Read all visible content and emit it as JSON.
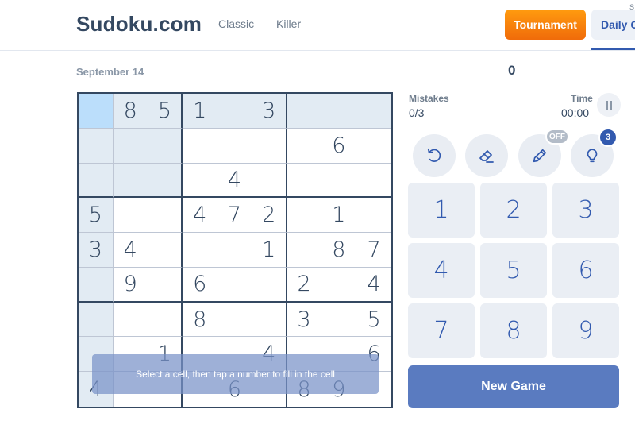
{
  "header": {
    "logo": "Sudoku.com",
    "nav": [
      "Classic",
      "Killer"
    ],
    "tournament_label": "Tournament",
    "daily_label": "Daily C",
    "daily_small": "S"
  },
  "game": {
    "date": "September 14",
    "score": "0",
    "mistakes_label": "Mistakes",
    "mistakes_value": "0/3",
    "time_label": "Time",
    "time_value": "00:00",
    "notes_badge": "OFF",
    "hints_badge": "3",
    "toast": "Select a cell, then tap a number to fill in the cell",
    "new_game_label": "New Game"
  },
  "board": [
    [
      "",
      "8",
      "5",
      "1",
      "",
      "3",
      "",
      "",
      ""
    ],
    [
      "",
      "",
      "",
      "",
      "",
      "",
      "",
      "6",
      ""
    ],
    [
      "",
      "",
      "",
      "",
      "4",
      "",
      "",
      "",
      ""
    ],
    [
      "5",
      "",
      "",
      "4",
      "7",
      "2",
      "",
      "1",
      ""
    ],
    [
      "3",
      "4",
      "",
      "",
      "",
      "1",
      "",
      "8",
      "7"
    ],
    [
      "",
      "9",
      "",
      "6",
      "",
      "",
      "2",
      "",
      "4"
    ],
    [
      "",
      "",
      "",
      "8",
      "",
      "",
      "3",
      "",
      "5"
    ],
    [
      "",
      "",
      "1",
      "",
      "",
      "4",
      "",
      "",
      "6"
    ],
    [
      "4",
      "",
      "",
      "",
      "6",
      "",
      "8",
      "9",
      ""
    ]
  ],
  "selected_cell": {
    "row": 0,
    "col": 0
  },
  "numpad": [
    "1",
    "2",
    "3",
    "4",
    "5",
    "6",
    "7",
    "8",
    "9"
  ],
  "tools": [
    "undo-icon",
    "eraser-icon",
    "pencil-icon",
    "lightbulb-icon"
  ],
  "colors": {
    "accent": "#325aaf",
    "tournament_orange": "#f57c0f",
    "selected_cell": "#bbdefb",
    "highlight_cell": "#e2ebf3",
    "text": "#344861"
  }
}
